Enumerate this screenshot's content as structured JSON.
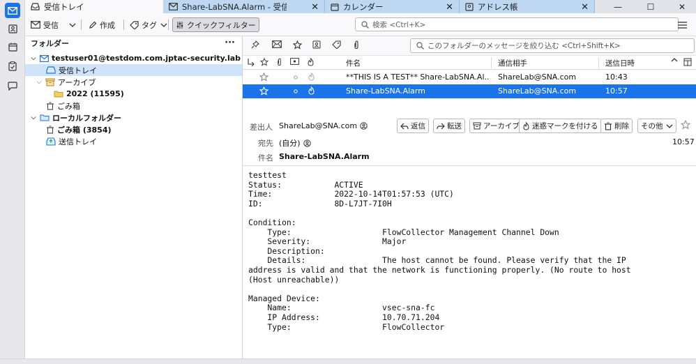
{
  "window": {
    "tabs": [
      {
        "label": "受信トレイ"
      },
      {
        "label": "Share-LabSNA.Alarm - 受信"
      },
      {
        "label": "カレンダー"
      },
      {
        "label": "アドレス帳"
      }
    ],
    "controls": {
      "minimize": "—",
      "maximize": "☐",
      "close": "✕"
    }
  },
  "toolbar": {
    "get_messages_label": "受信",
    "write_label": "作成",
    "tag_label": "タグ",
    "quick_filter_label": "クイックフィルター",
    "search_placeholder": "検索 <Ctrl+K>"
  },
  "folder_pane": {
    "header": "フォルダー",
    "more": "···",
    "tree": [
      {
        "label": "testuser01@testdom.com.jptac-security.lab"
      },
      {
        "label": "受信トレイ"
      },
      {
        "label": "アーカイブ"
      },
      {
        "label": "2022 (11595)"
      },
      {
        "label": "ごみ箱"
      },
      {
        "label": "ローカルフォルダー"
      },
      {
        "label": "ごみ箱 (3854)"
      },
      {
        "label": "送信トレイ"
      }
    ]
  },
  "message_list": {
    "filter_placeholder": "このフォルダーのメッセージを絞り込む <Ctrl+Shift+K>",
    "columns": {
      "subject": "件名",
      "correspondent": "通信相手",
      "date": "送信日時"
    },
    "messages": [
      {
        "subject": "**THIS IS A TEST** Share-LabSNA.Al...",
        "correspondent": "ShareLab@SNA.com",
        "date": "10:43"
      },
      {
        "subject": "Share-LabSNA.Alarm",
        "correspondent": "ShareLab@SNA.com",
        "date": "10:57"
      }
    ]
  },
  "message_header": {
    "from_label": "差出人",
    "from_value": "ShareLab@SNA.com",
    "to_label": "宛先",
    "to_value": "(自分)",
    "subject_label": "件名",
    "subject_value": "Share-LabSNA.Alarm",
    "time": "10:57",
    "buttons": {
      "reply": "返信",
      "forward": "転送",
      "archive": "アーカイブ",
      "junk": "迷惑マークを付ける",
      "delete": "削除",
      "more": "その他"
    }
  },
  "message_body": "testtest\nStatus:           ACTIVE\nTime:             2022-10-14T01:57:53 (UTC)\nID:               8D-L7JT-7I0H\n\nCondition:\n    Type:                   FlowCollector Management Channel Down\n    Severity:               Major\n    Description:\n    Details:                The host cannot be found. Please verify that the IP\naddress is valid and that the network is functioning properly. (No route to host\n(Host unreachable))\n\nManaged Device:\n    Name:                   vsec-sna-fc\n    IP Address:             10.70.71.204\n    Type:                   FlowCollector",
  "colors": {
    "accent": "#1a73e8",
    "selection_light": "#cfe3fa",
    "inactive_tab": "#bdd8f0",
    "folder_yellow": "#e8b84a"
  }
}
